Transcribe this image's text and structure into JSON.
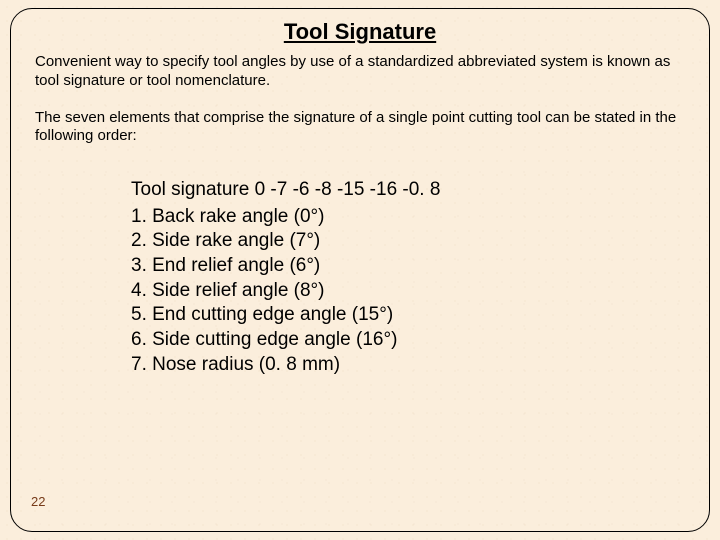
{
  "title": "Tool Signature",
  "para1": "Convenient way to specify tool angles by use of a standardized abbreviated system is known as tool signature or tool nomenclature.",
  "para2": "The seven elements that comprise the signature of a single point cutting tool can be stated in the following order:",
  "signature_line": "Tool signature 0 -7 -6 -8 -15 -16 -0. 8",
  "items": [
    "1. Back rake angle (0°)",
    "2. Side rake angle (7°)",
    "3. End relief angle (6°)",
    "4. Side relief angle (8°)",
    "5. End cutting edge angle (15°)",
    "6. Side cutting edge angle (16°)",
    "7. Nose radius (0. 8 mm)"
  ],
  "page_number": "22"
}
